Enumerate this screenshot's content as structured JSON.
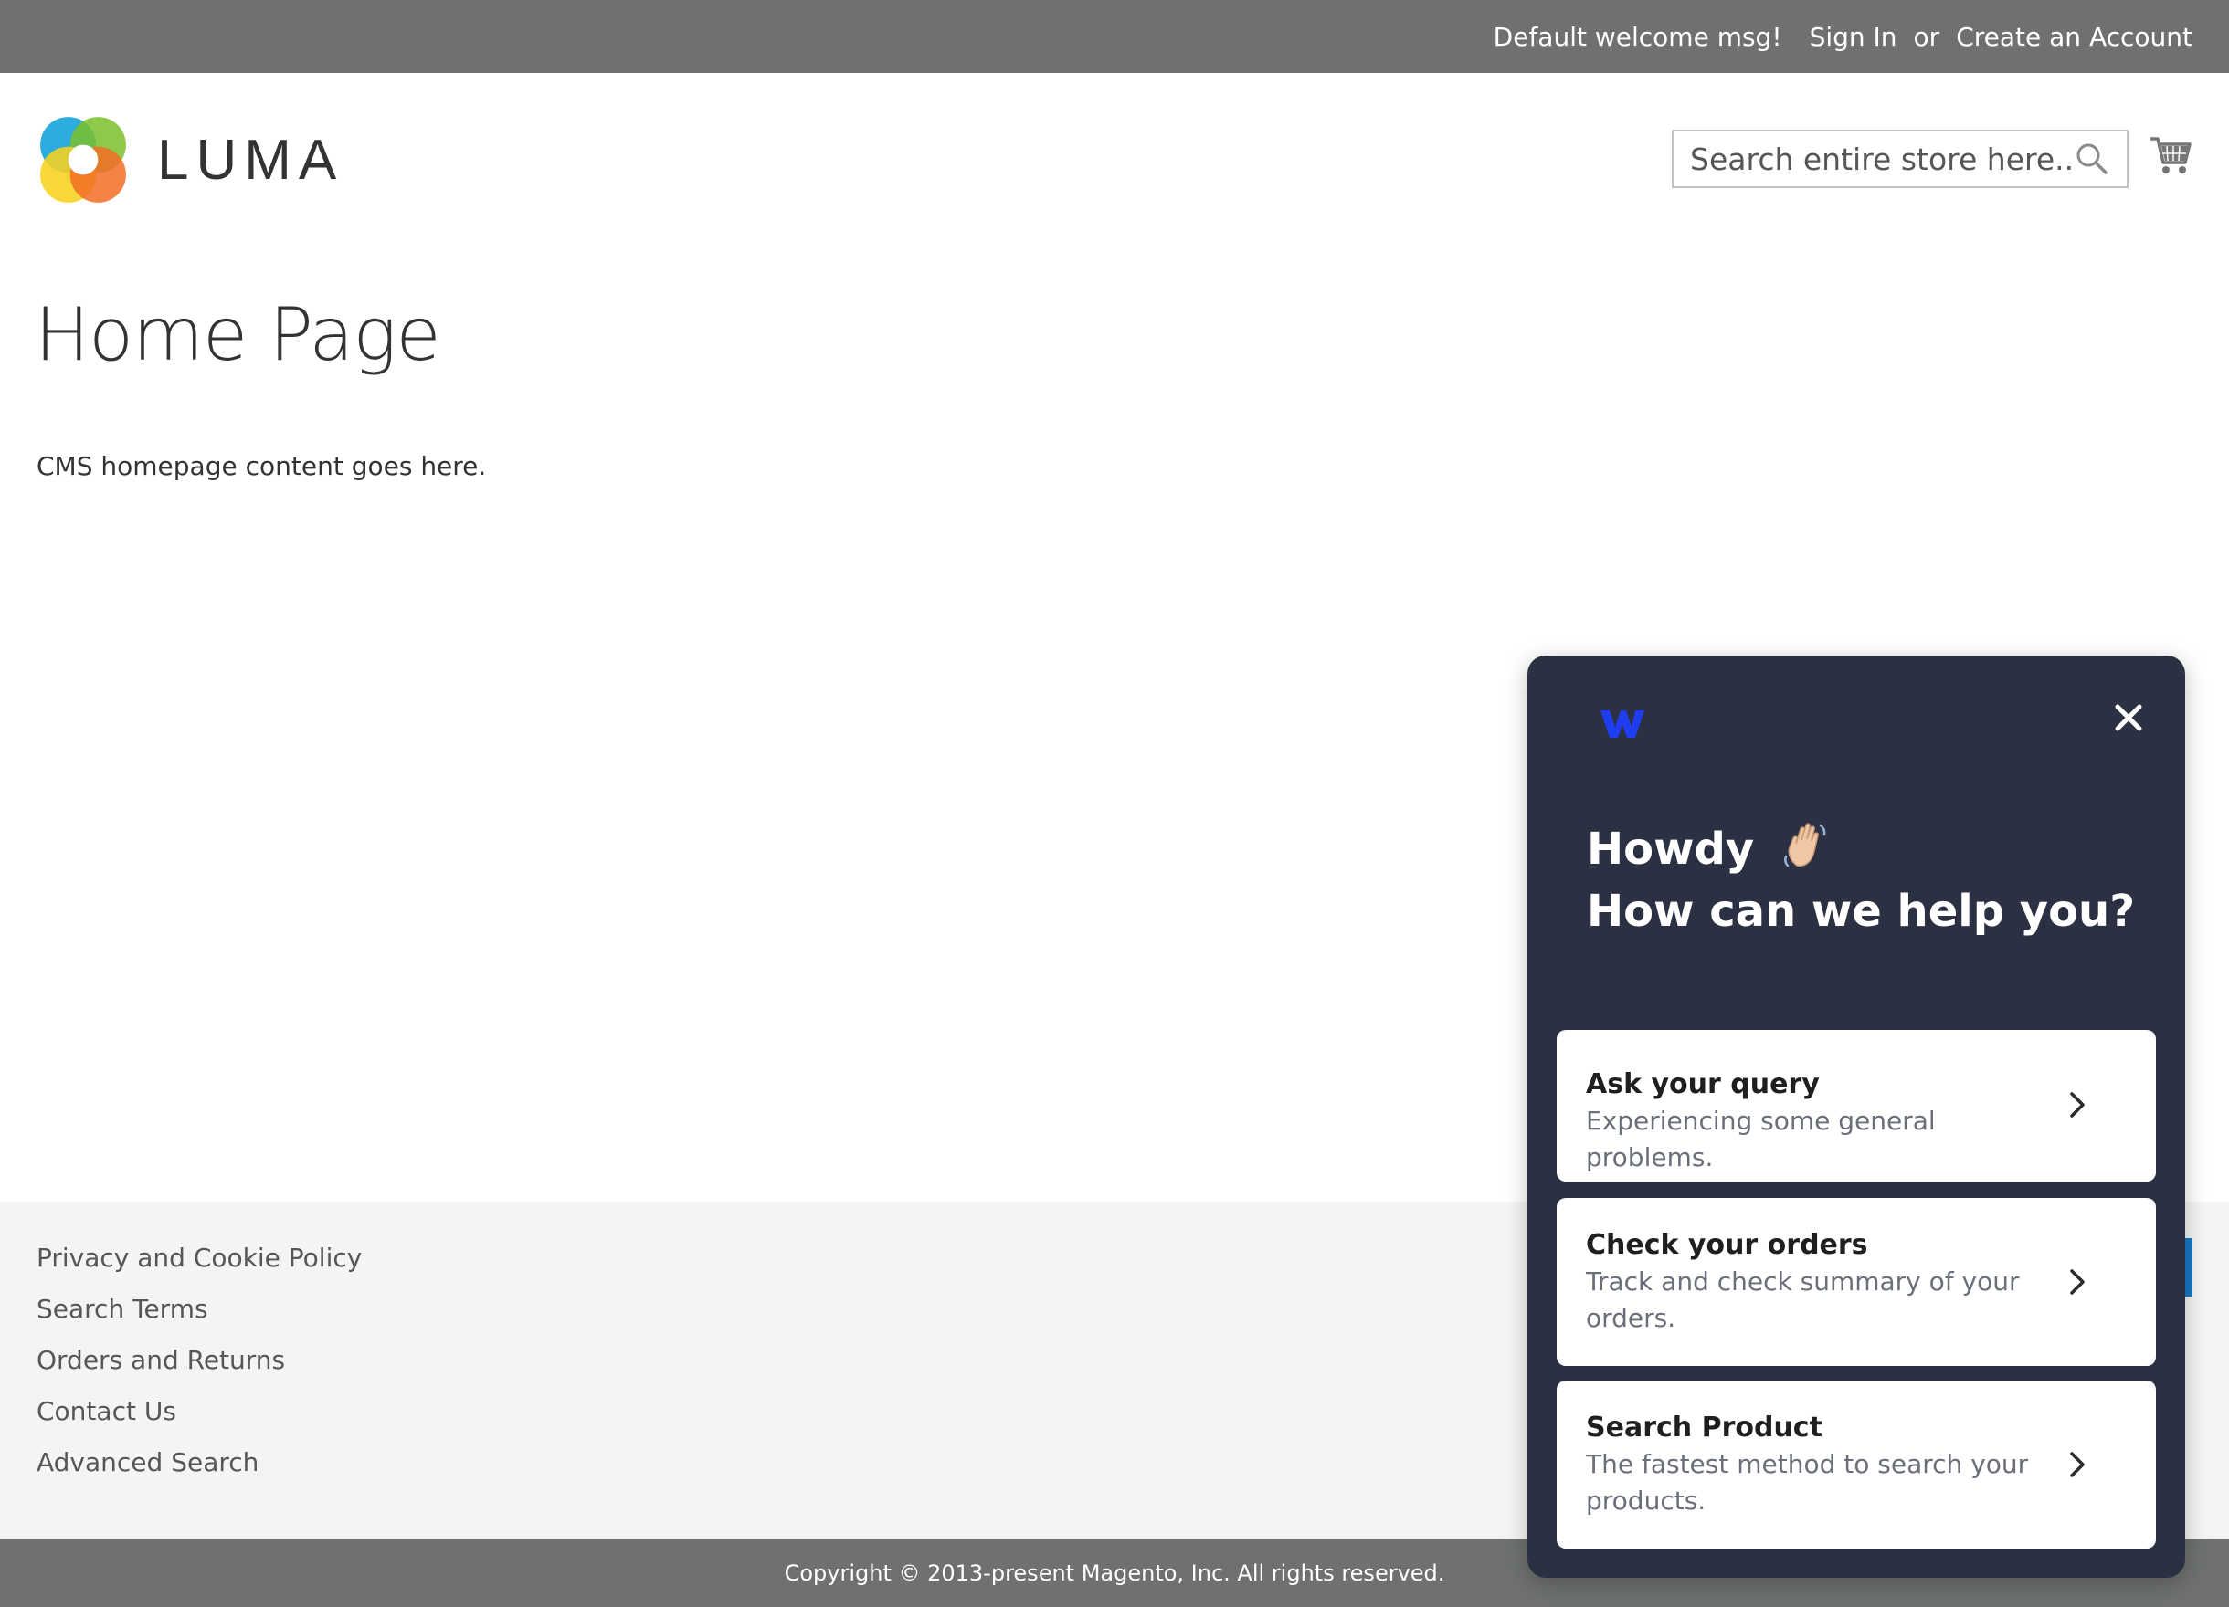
{
  "topbar": {
    "welcome": "Default welcome msg!",
    "sign_in": "Sign In",
    "or": "or",
    "create_account": "Create an Account"
  },
  "header": {
    "logo_text": "LUMA",
    "search_placeholder": "Search entire store here...",
    "icons": [
      "search-icon",
      "cart-icon"
    ]
  },
  "main": {
    "title": "Home Page",
    "content": "CMS homepage content goes here."
  },
  "footer": {
    "links": [
      "Privacy and Cookie Policy",
      "Search Terms",
      "Orders and Returns",
      "Contact Us",
      "Advanced Search"
    ],
    "copyright": "Copyright © 2013-present Magento, Inc. All rights reserved."
  },
  "widget": {
    "greeting_line1": "Howdy",
    "greeting_line2": "How can we help you?",
    "icons": [
      "widget-logo-icon",
      "close-icon",
      "waving-hand-icon",
      "chevron-right-icon"
    ],
    "cards": [
      {
        "title": "Ask your query",
        "description": "Experiencing some general problems."
      },
      {
        "title": "Check your orders",
        "description": "Track and check summary of your orders."
      },
      {
        "title": "Search Product",
        "description": "The fastest method to search your products."
      }
    ]
  },
  "colors": {
    "topbar_bg": "#6e716e",
    "footer_bg": "#f4f4f4",
    "widget_bg": "#2b3042",
    "widget_logo": "#1f3df0",
    "footer_accent": "#1979c3"
  }
}
